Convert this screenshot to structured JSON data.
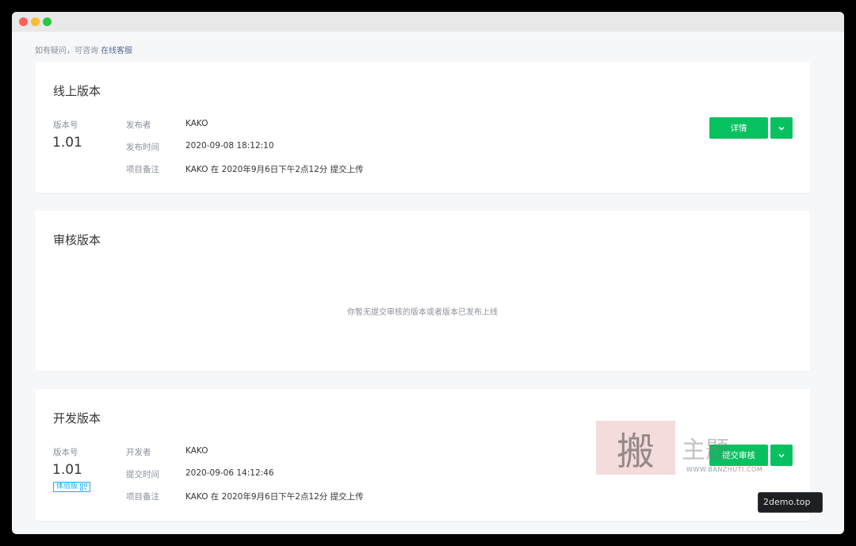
{
  "notice": {
    "text": "如有疑问，可咨询",
    "link": "在线客服"
  },
  "online": {
    "title": "线上版本",
    "version_label": "版本号",
    "version": "1.01",
    "publisher_key": "发布者",
    "publisher": "KAKO",
    "time_key": "发布时间",
    "time": "2020-09-08 18:12:10",
    "note_key": "项目备注",
    "note": "KAKO 在 2020年9月6日下午2点12分 提交上传",
    "detail_button": "详情"
  },
  "review": {
    "title": "审核版本",
    "empty_text": "你暂无提交审核的版本或者版本已发布上线"
  },
  "dev": {
    "title": "开发版本",
    "version_label": "版本号",
    "version": "1.01",
    "tag": "体验版",
    "developer_key": "开发者",
    "developer": "KAKO",
    "time_key": "提交时间",
    "time": "2020-09-06 14:12:46",
    "note_key": "项目备注",
    "note": "KAKO 在 2020年9月6日下午2点12分 提交上传",
    "submit_button": "提交审核"
  },
  "watermark": {
    "stamp": "搬",
    "chars": "主题",
    "url": "WWW.BANZHUTI.COM"
  },
  "site_badge": "2demo.top",
  "colors": {
    "primary": "#07c160",
    "link": "#576b95",
    "tag": "#10aeff"
  }
}
